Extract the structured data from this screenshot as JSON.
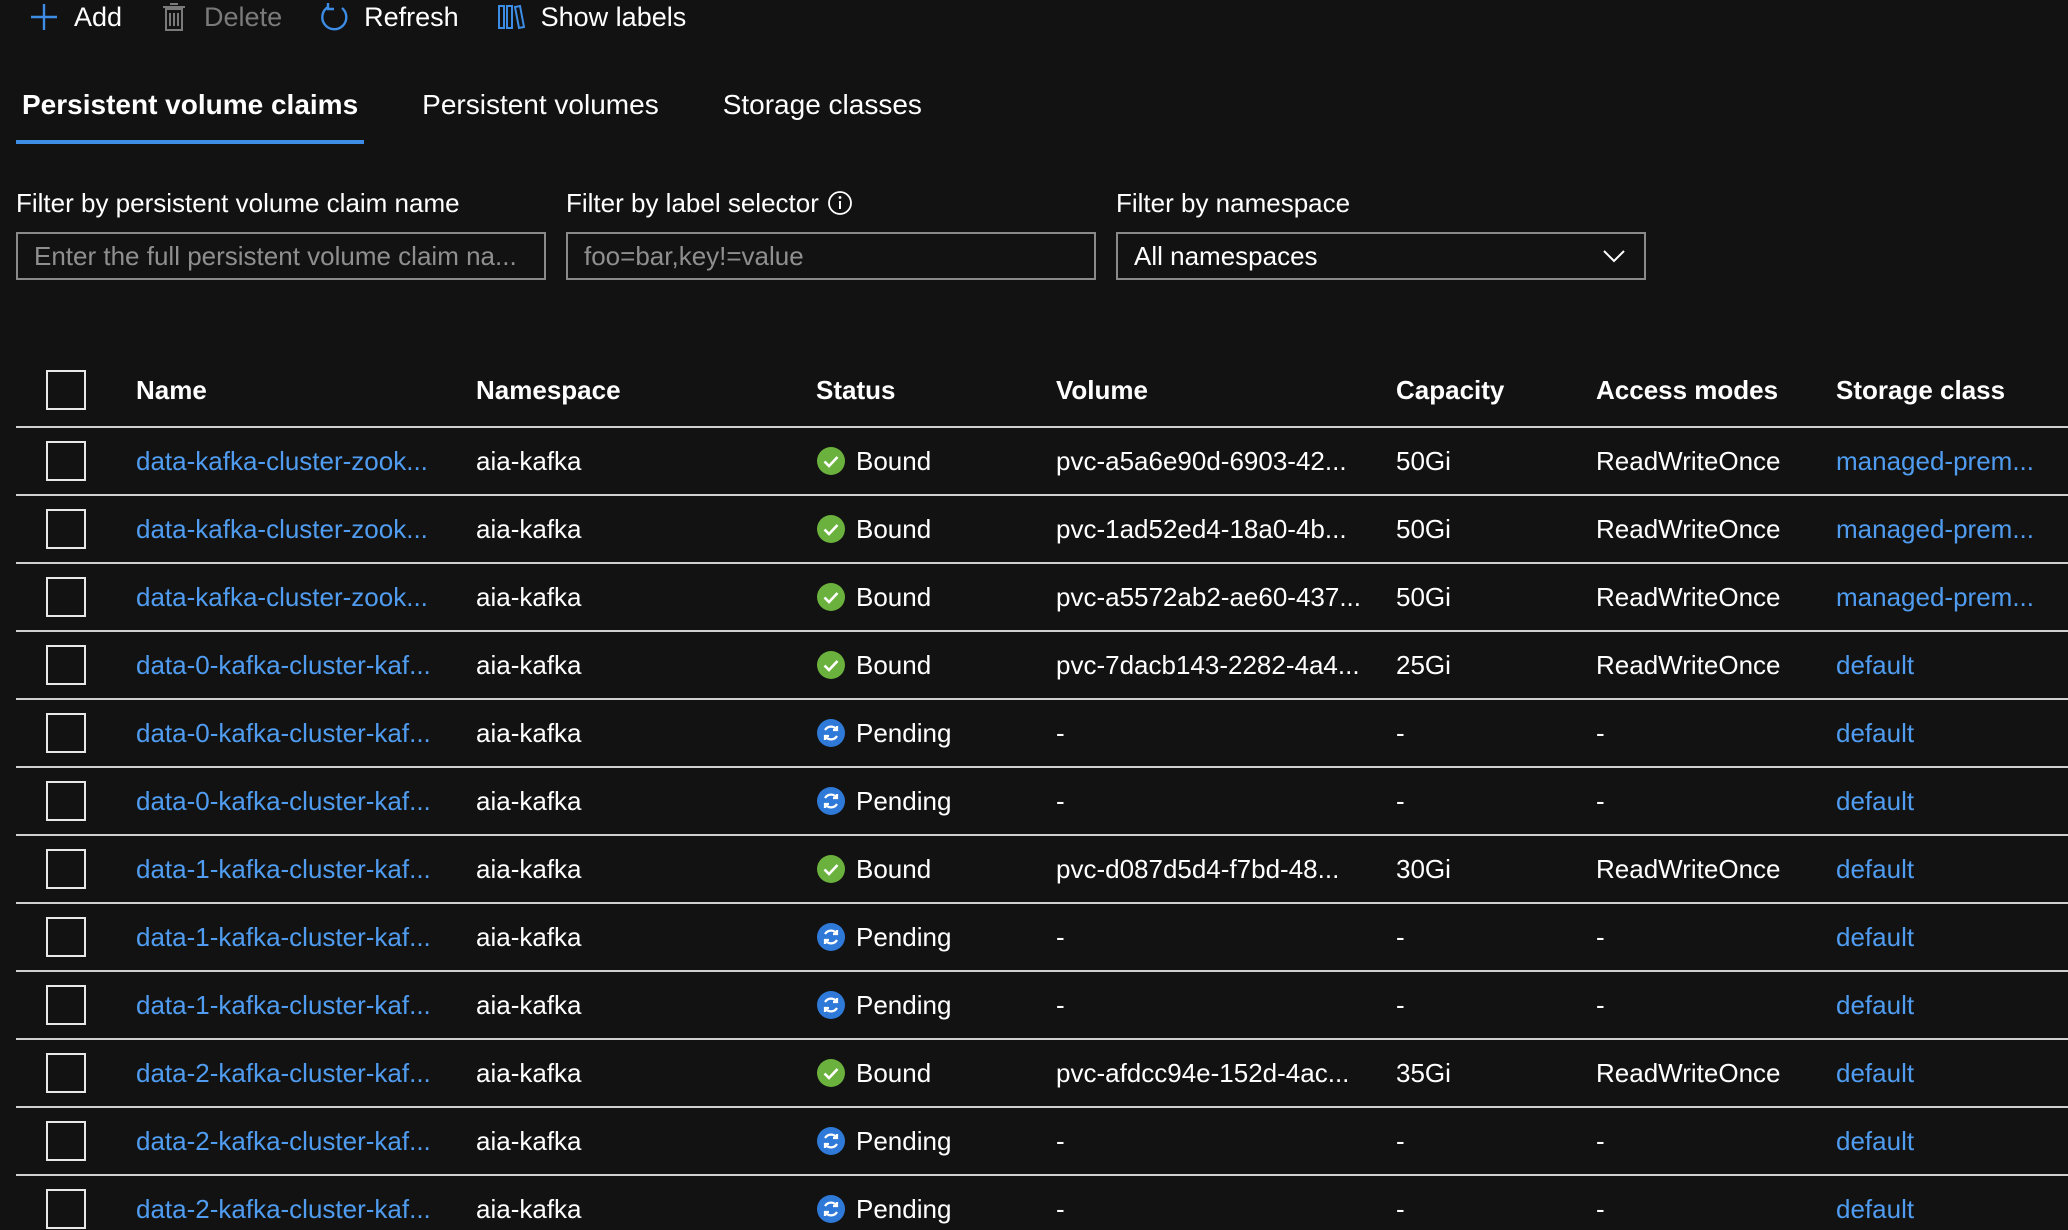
{
  "toolbar": {
    "add": {
      "label": "Add",
      "icon": "plus-icon"
    },
    "delete": {
      "label": "Delete",
      "icon": "trash-icon"
    },
    "refresh": {
      "label": "Refresh",
      "icon": "refresh-icon"
    },
    "show_labels": {
      "label": "Show labels",
      "icon": "labels-icon"
    }
  },
  "tabs": [
    {
      "label": "Persistent volume claims",
      "active": true
    },
    {
      "label": "Persistent volumes",
      "active": false
    },
    {
      "label": "Storage classes",
      "active": false
    }
  ],
  "filters": {
    "name": {
      "label": "Filter by persistent volume claim name",
      "placeholder": "Enter the full persistent volume claim na...",
      "value": ""
    },
    "label": {
      "label": "Filter by label selector",
      "placeholder": "foo=bar,key!=value",
      "value": ""
    },
    "namespace": {
      "label": "Filter by namespace",
      "selected": "All namespaces"
    }
  },
  "table": {
    "headers": {
      "name": "Name",
      "namespace": "Namespace",
      "status": "Status",
      "volume": "Volume",
      "capacity": "Capacity",
      "access_modes": "Access modes",
      "storage_class": "Storage class"
    },
    "rows": [
      {
        "name": "data-kafka-cluster-zook...",
        "namespace": "aia-kafka",
        "status": "Bound",
        "volume": "pvc-a5a6e90d-6903-42...",
        "capacity": "50Gi",
        "access_modes": "ReadWriteOnce",
        "storage_class": "managed-prem..."
      },
      {
        "name": "data-kafka-cluster-zook...",
        "namespace": "aia-kafka",
        "status": "Bound",
        "volume": "pvc-1ad52ed4-18a0-4b...",
        "capacity": "50Gi",
        "access_modes": "ReadWriteOnce",
        "storage_class": "managed-prem..."
      },
      {
        "name": "data-kafka-cluster-zook...",
        "namespace": "aia-kafka",
        "status": "Bound",
        "volume": "pvc-a5572ab2-ae60-437...",
        "capacity": "50Gi",
        "access_modes": "ReadWriteOnce",
        "storage_class": "managed-prem..."
      },
      {
        "name": "data-0-kafka-cluster-kaf...",
        "namespace": "aia-kafka",
        "status": "Bound",
        "volume": "pvc-7dacb143-2282-4a4...",
        "capacity": "25Gi",
        "access_modes": "ReadWriteOnce",
        "storage_class": "default"
      },
      {
        "name": "data-0-kafka-cluster-kaf...",
        "namespace": "aia-kafka",
        "status": "Pending",
        "volume": "-",
        "capacity": "-",
        "access_modes": "-",
        "storage_class": "default"
      },
      {
        "name": "data-0-kafka-cluster-kaf...",
        "namespace": "aia-kafka",
        "status": "Pending",
        "volume": "-",
        "capacity": "-",
        "access_modes": "-",
        "storage_class": "default"
      },
      {
        "name": "data-1-kafka-cluster-kaf...",
        "namespace": "aia-kafka",
        "status": "Bound",
        "volume": "pvc-d087d5d4-f7bd-48...",
        "capacity": "30Gi",
        "access_modes": "ReadWriteOnce",
        "storage_class": "default"
      },
      {
        "name": "data-1-kafka-cluster-kaf...",
        "namespace": "aia-kafka",
        "status": "Pending",
        "volume": "-",
        "capacity": "-",
        "access_modes": "-",
        "storage_class": "default"
      },
      {
        "name": "data-1-kafka-cluster-kaf...",
        "namespace": "aia-kafka",
        "status": "Pending",
        "volume": "-",
        "capacity": "-",
        "access_modes": "-",
        "storage_class": "default"
      },
      {
        "name": "data-2-kafka-cluster-kaf...",
        "namespace": "aia-kafka",
        "status": "Bound",
        "volume": "pvc-afdcc94e-152d-4ac...",
        "capacity": "35Gi",
        "access_modes": "ReadWriteOnce",
        "storage_class": "default"
      },
      {
        "name": "data-2-kafka-cluster-kaf...",
        "namespace": "aia-kafka",
        "status": "Pending",
        "volume": "-",
        "capacity": "-",
        "access_modes": "-",
        "storage_class": "default"
      },
      {
        "name": "data-2-kafka-cluster-kaf...",
        "namespace": "aia-kafka",
        "status": "Pending",
        "volume": "-",
        "capacity": "-",
        "access_modes": "-",
        "storage_class": "default"
      }
    ]
  },
  "colors": {
    "background": "#121212",
    "accent": "#3d8de6",
    "link": "#4f9cf0",
    "bound": "#6bb13d",
    "pending": "#2f7ad8"
  }
}
